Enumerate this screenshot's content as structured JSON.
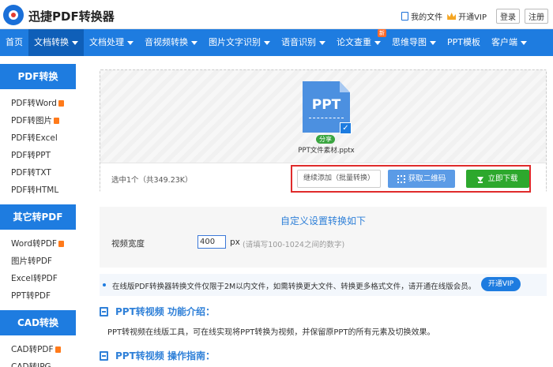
{
  "header": {
    "brand": "迅捷PDF转换器",
    "links": [
      {
        "label": "我的文件",
        "icon": "document-icon"
      },
      {
        "label": "开通VIP",
        "icon": "crown-icon"
      }
    ],
    "login": "登录",
    "register": "注册"
  },
  "nav": {
    "items": [
      {
        "label": "首页",
        "caret": false
      },
      {
        "label": "文档转换",
        "caret": true,
        "active": true
      },
      {
        "label": "文档处理",
        "caret": true
      },
      {
        "label": "音视频转换",
        "caret": true
      },
      {
        "label": "图片文字识别",
        "caret": true
      },
      {
        "label": "语音识别",
        "caret": true
      },
      {
        "label": "论文查重",
        "caret": true,
        "badge": "新"
      },
      {
        "label": "思维导图",
        "caret": true
      },
      {
        "label": "PPT模板",
        "caret": false
      },
      {
        "label": "客户端",
        "caret": true
      }
    ]
  },
  "sidebar": {
    "groups": [
      {
        "title": "PDF转换",
        "items": [
          {
            "label": "PDF转Word",
            "hot": true
          },
          {
            "label": "PDF转图片",
            "hot": true
          },
          {
            "label": "PDF转Excel",
            "hot": false
          },
          {
            "label": "PDF转PPT",
            "hot": false
          },
          {
            "label": "PDF转TXT",
            "hot": false
          },
          {
            "label": "PDF转HTML",
            "hot": false
          }
        ]
      },
      {
        "title": "其它转PDF",
        "items": [
          {
            "label": "Word转PDF",
            "hot": true
          },
          {
            "label": "图片转PDF",
            "hot": false
          },
          {
            "label": "Excel转PDF",
            "hot": false
          },
          {
            "label": "PPT转PDF",
            "hot": false
          }
        ]
      },
      {
        "title": "CAD转换",
        "items": [
          {
            "label": "CAD转PDF",
            "hot": true
          },
          {
            "label": "CAD转JPG",
            "hot": false
          }
        ]
      }
    ]
  },
  "upload": {
    "file_icon_text": "PPT",
    "share_label": "分享",
    "file_name": "PPT文件素材.pptx",
    "selected_text": "选中1个（共349.23K）",
    "add_button": "继续添加（批量转换）",
    "qr_button": "获取二维码",
    "download_button": "立即下载"
  },
  "settings": {
    "title": "自定义设置转换如下",
    "width_label": "视频宽度",
    "width_value": "400",
    "unit": "px",
    "hint": "(请填写100-1024之间的数字)"
  },
  "notice": {
    "text": "在线版PDF转换器转换文件仅限于2M以内文件，如需转换更大文件、转换更多格式文件，请开通在线版会员。",
    "vip_button": "开通VIP"
  },
  "intro": {
    "title": "PPT转视频 功能介绍：",
    "desc": "PPT转视频在线版工具，可在线实现将PPT转换为视频，并保留原PPT的所有元素及切换效果。",
    "guide_title": "PPT转视频 操作指南："
  },
  "colors": {
    "primary": "#1e7ce0",
    "download_green": "#2da82d",
    "highlight_red": "#e02b2b"
  }
}
